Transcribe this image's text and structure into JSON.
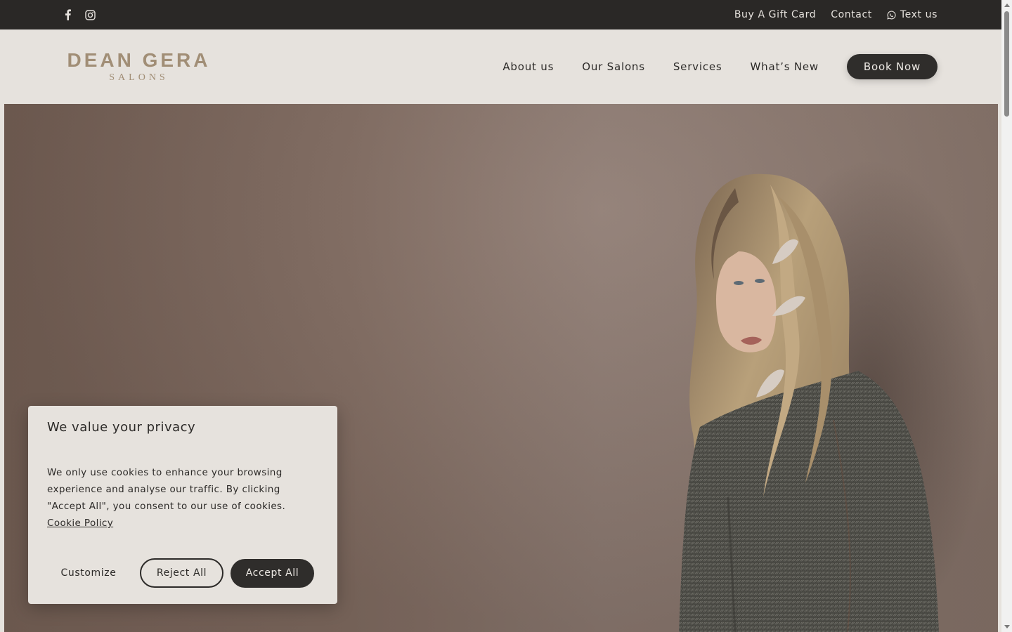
{
  "topbar": {
    "social": [
      {
        "icon": "facebook-icon"
      },
      {
        "icon": "instagram-icon"
      }
    ],
    "links": {
      "gift_card": "Buy A Gift Card",
      "contact": "Contact",
      "text_us": "Text us"
    }
  },
  "header": {
    "logo": {
      "main": "DEAN GERA",
      "sub": "SALONS"
    },
    "nav": {
      "about": "About us",
      "salons": "Our Salons",
      "services": "Services",
      "whats_new": "What’s New"
    },
    "book_label": "Book Now"
  },
  "cookie": {
    "title": "We value your privacy",
    "text": "We only use cookies to enhance your browsing experience and analyse our traffic. By clicking \"Accept All\", you consent to our use of cookies.",
    "link": "Cookie Policy",
    "customize": "Customize",
    "reject": "Reject All",
    "accept": "Accept All"
  },
  "colors": {
    "topbar_bg": "#2a2826",
    "header_bg": "#e6e2dd",
    "logo": "#a18e76",
    "button_dark": "#2f2d2b"
  }
}
